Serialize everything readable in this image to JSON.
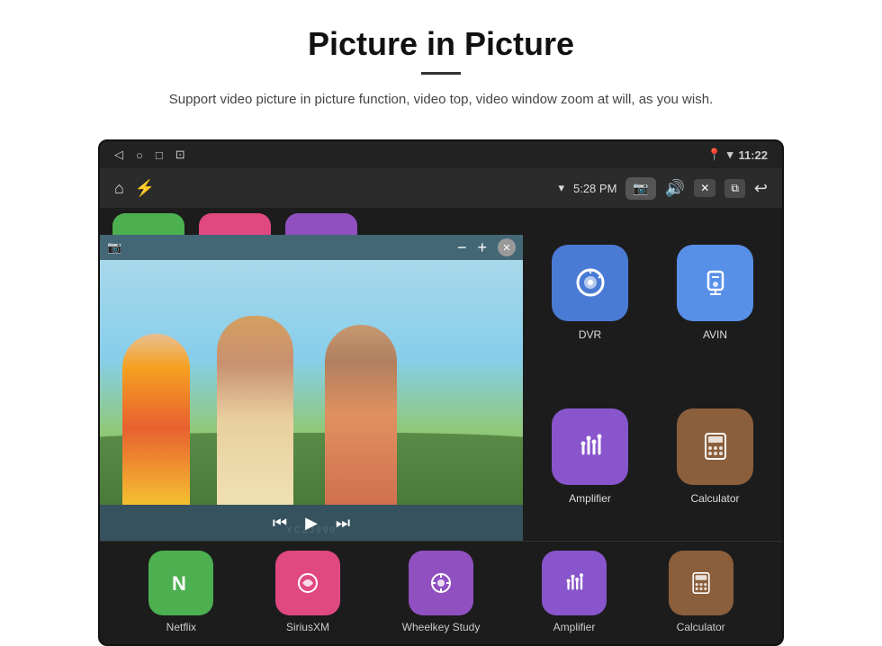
{
  "header": {
    "title": "Picture in Picture",
    "subtitle": "Support video picture in picture function, video top, video window zoom at will, as you wish."
  },
  "statusBar": {
    "time": "11:22",
    "icons": [
      "◁",
      "○",
      "□",
      "⊡"
    ]
  },
  "toolbar": {
    "time": "5:28 PM",
    "homeIcon": "⌂",
    "usbIcon": "⚡"
  },
  "pipControls": {
    "minus": "−",
    "plus": "+",
    "close": "✕",
    "prev": "⏮",
    "play": "▶",
    "next": "⏭"
  },
  "gridApps": [
    {
      "label": "DVR",
      "color": "#4a7bd4"
    },
    {
      "label": "AVIN",
      "color": "#5890e8"
    },
    {
      "label": "Amplifier",
      "color": "#8855cc"
    },
    {
      "label": "Calculator",
      "color": "#8b5e3c"
    }
  ],
  "bottomApps": [
    {
      "label": "Netflix",
      "color": "#4caf50"
    },
    {
      "label": "SiriusXM",
      "color": "#e04880"
    },
    {
      "label": "Wheelkey Study",
      "color": "#9050c0"
    },
    {
      "label": "Amplifier",
      "color": "#8855cc"
    },
    {
      "label": "Calculator",
      "color": "#8b5e3c"
    }
  ]
}
